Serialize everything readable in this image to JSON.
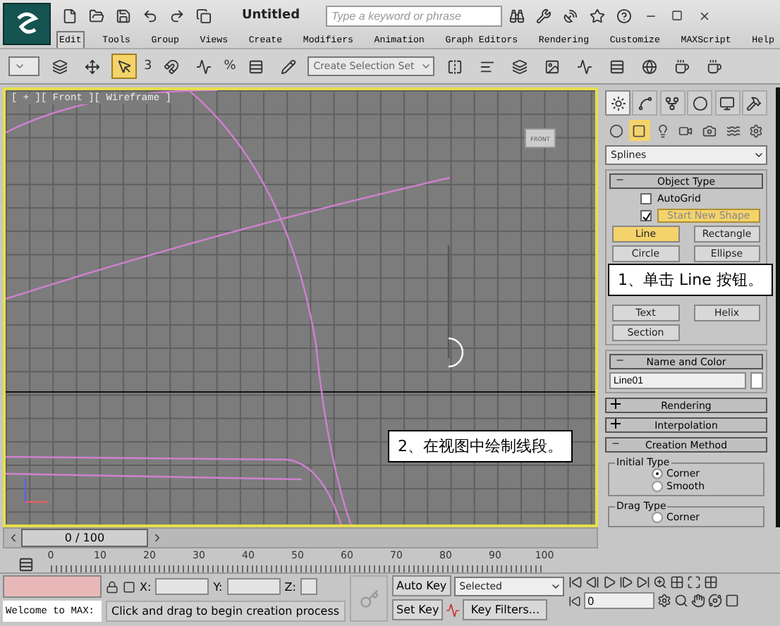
{
  "app": {
    "title": "Untitled",
    "search_placeholder": "Type a keyword or phrase"
  },
  "menu": [
    {
      "label": "Edit",
      "selected": true
    },
    {
      "label": "Tools",
      "selected": false
    },
    {
      "label": "Group",
      "selected": false
    },
    {
      "label": "Views",
      "selected": false
    },
    {
      "label": "Create",
      "selected": false
    },
    {
      "label": "Modifiers",
      "selected": false
    },
    {
      "label": "Animation",
      "selected": false
    },
    {
      "label": "Graph Editors",
      "selected": false
    },
    {
      "label": "Rendering",
      "selected": false
    },
    {
      "label": "Customize",
      "selected": false
    },
    {
      "label": "MAXScript",
      "selected": false
    },
    {
      "label": "Help",
      "selected": false
    }
  ],
  "toolbar": {
    "selection_set": "Create Selection Set",
    "number_label": "3",
    "percent_label": "%"
  },
  "viewport": {
    "label": "[ + ][ Front ][ Wireframe ]",
    "viewcube": "FRONT"
  },
  "callouts": [
    {
      "text": "1、单击 Line 按钮。"
    },
    {
      "text": "2、在视图中绘制线段。"
    }
  ],
  "command_panel": {
    "tabs": [
      {
        "selected": true
      },
      {
        "selected": false
      },
      {
        "selected": false
      },
      {
        "selected": false
      },
      {
        "selected": false
      },
      {
        "selected": false
      }
    ],
    "categories": [
      {
        "selected": false
      },
      {
        "selected": true
      },
      {
        "selected": false
      },
      {
        "selected": false
      },
      {
        "selected": false
      },
      {
        "selected": false
      },
      {
        "selected": false
      }
    ],
    "type": "Splines",
    "object_type": {
      "title": "Object Type",
      "expanded": true,
      "options": [
        {
          "label": "AutoGrid",
          "checked": false
        },
        {
          "label": "Start New Shape",
          "checked": true
        }
      ],
      "buttons": [
        {
          "label": "Line",
          "selected": true
        },
        {
          "label": "Rectangle",
          "selected": false
        },
        {
          "label": "Circle",
          "selected": false
        },
        {
          "label": "Ellipse",
          "selected": false
        },
        {
          "label": "Text",
          "selected": false
        },
        {
          "label": "Helix",
          "selected": false
        },
        {
          "label": "Section",
          "selected": false
        }
      ]
    },
    "name_and_color": {
      "title": "Name and Color",
      "expanded": true,
      "name": "Line01"
    },
    "rollouts": [
      {
        "title": "Rendering",
        "expanded": false
      },
      {
        "title": "Interpolation",
        "expanded": false
      },
      {
        "title": "Creation Method",
        "expanded": true
      }
    ],
    "groups": [
      {
        "title": "Initial Type",
        "options": [
          {
            "label": "Corner",
            "selected": true
          },
          {
            "label": "Smooth",
            "selected": false
          }
        ]
      },
      {
        "title": "Drag Type",
        "options": [
          {
            "label": "Corner",
            "selected": false
          }
        ]
      }
    ]
  },
  "time_slider": {
    "position": "0 / 100",
    "ticks": [
      "0",
      "10",
      "20",
      "30",
      "40",
      "50",
      "60",
      "70",
      "80",
      "90",
      "100"
    ]
  },
  "status": {
    "listener": "Welcome to MAX:",
    "prompt": "Click and drag to begin creation process",
    "coords": [
      "X:",
      "Y:",
      "Z:"
    ],
    "auto_key": "Auto Key",
    "key_mode": "Selected",
    "set_key": "Set Key",
    "key_filters": "Key Filters...",
    "frame": "0"
  }
}
